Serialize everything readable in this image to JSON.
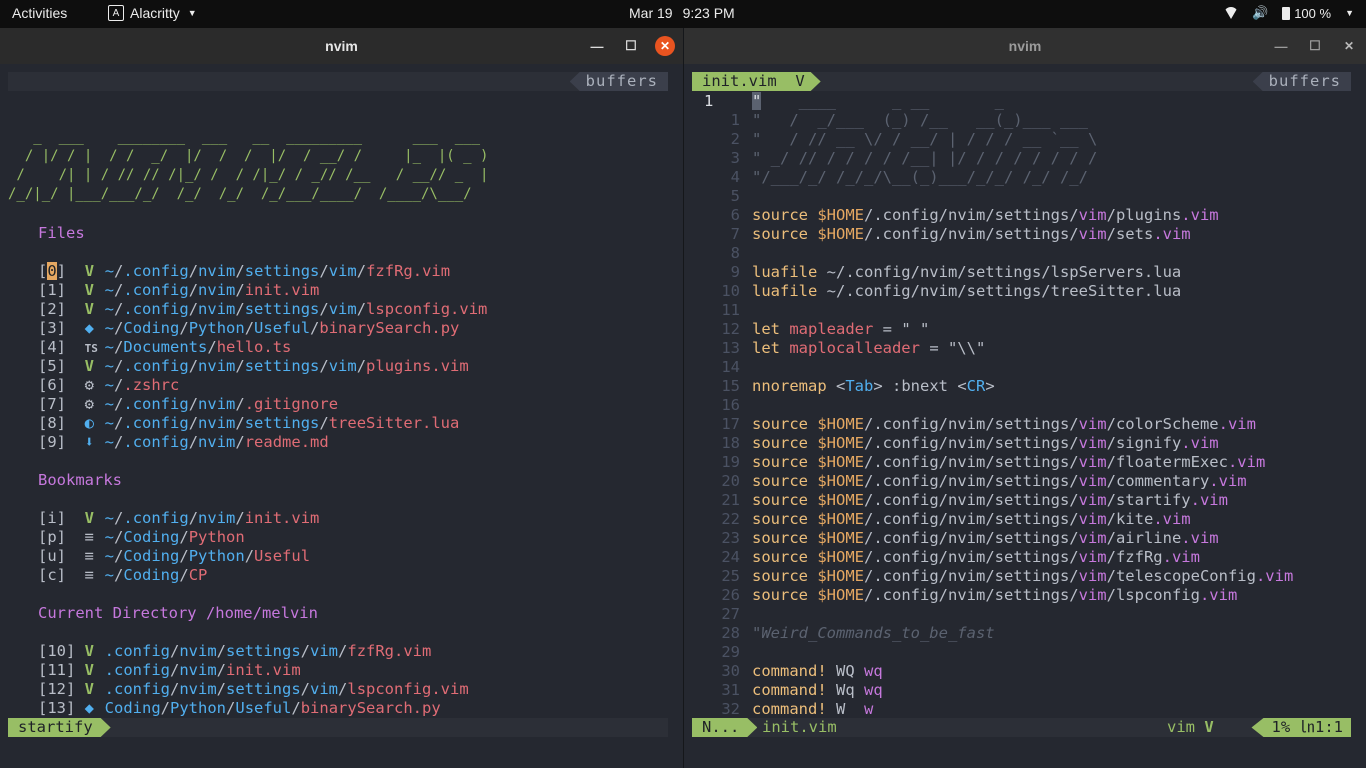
{
  "topbar": {
    "activities": "Activities",
    "app_name": "Alacritty",
    "date": "Mar 19",
    "time": "9:23 PM",
    "battery": "100 %"
  },
  "left": {
    "title": "nvim",
    "buffers_label": "buffers",
    "banner": [
      "   _  ___    ________  ___   __  _________      ___  ___",
      "  / |/ / |  / /  _/  |/  /  /  |/  / __/ /     |_  |( _ )",
      " /    /| | / // // /|_/ /  / /|_/ / _// /__   / __// _  |",
      "/_/|_/ |___/___/_/  /_/  /_/  /_/___/____/  /____/\\___/"
    ],
    "sections": {
      "files": "Files",
      "bookmarks": "Bookmarks",
      "current_dir": "Current Directory /home/melvin"
    },
    "files": [
      {
        "idx": "[0]",
        "icon": "vim-icon",
        "dir": "~/.config/nvim/settings/vim/",
        "file": "fzfRg.vim"
      },
      {
        "idx": "[1]",
        "icon": "vim-icon",
        "dir": "~/.config/nvim/",
        "file": "init.vim"
      },
      {
        "idx": "[2]",
        "icon": "vim-icon",
        "dir": "~/.config/nvim/settings/vim/",
        "file": "lspconfig.vim"
      },
      {
        "idx": "[3]",
        "icon": "python-icon",
        "dir": "~/Coding/Python/Useful/",
        "file": "binarySearch.py"
      },
      {
        "idx": "[4]",
        "icon": "typescript-icon",
        "dir": "~/Documents/",
        "file": "hello.ts"
      },
      {
        "idx": "[5]",
        "icon": "vim-icon",
        "dir": "~/.config/nvim/settings/vim/",
        "file": "plugins.vim"
      },
      {
        "idx": "[6]",
        "icon": "gear-icon",
        "dir": "~/",
        "file": ".zshrc"
      },
      {
        "idx": "[7]",
        "icon": "gear-icon",
        "dir": "~/.config/nvim/",
        "file": ".gitignore"
      },
      {
        "idx": "[8]",
        "icon": "lua-icon",
        "dir": "~/.config/nvim/settings/",
        "file": "treeSitter.lua"
      },
      {
        "idx": "[9]",
        "icon": "markdown-icon",
        "dir": "~/.config/nvim/",
        "file": "readme.md"
      }
    ],
    "bookmarks": [
      {
        "idx": "[i]",
        "icon": "vim-icon",
        "dir": "~/.config/nvim/",
        "file": "init.vim"
      },
      {
        "idx": "[p]",
        "icon": "folder-list-icon",
        "dir": "~/Coding/",
        "file": "Python"
      },
      {
        "idx": "[u]",
        "icon": "folder-list-icon",
        "dir": "~/Coding/Python/",
        "file": "Useful"
      },
      {
        "idx": "[c]",
        "icon": "folder-list-icon",
        "dir": "~/Coding/",
        "file": "CP"
      }
    ],
    "current": [
      {
        "idx": "[10]",
        "icon": "vim-icon",
        "dir": ".config/nvim/settings/vim/",
        "file": "fzfRg.vim"
      },
      {
        "idx": "[11]",
        "icon": "vim-icon",
        "dir": ".config/nvim/",
        "file": "init.vim"
      },
      {
        "idx": "[12]",
        "icon": "vim-icon",
        "dir": ".config/nvim/settings/vim/",
        "file": "lspconfig.vim"
      },
      {
        "idx": "[13]",
        "icon": "python-icon",
        "dir": "Coding/Python/Useful/",
        "file": "binarySearch.py"
      }
    ],
    "status_mode": "startify"
  },
  "right": {
    "title": "nvim",
    "active_tab": "init.vim",
    "buffers_label": "buffers",
    "code": [
      {
        "n": "1",
        "t": "\"    ____      _ __       _"
      },
      {
        "n": "1",
        "t": "\"   /  _/___  (_) /__   __(_)___ ___"
      },
      {
        "n": "2",
        "t": "\"   / // __ \\/ / __/ | / / / __ `__ \\"
      },
      {
        "n": "3",
        "t": "\" _/ // / / / / /__| |/ / / / / / / /"
      },
      {
        "n": "4",
        "t": "\"/___/_/ /_/_/\\__(_)___/_/_/ /_/ /_/"
      },
      {
        "n": "5",
        "t": ""
      },
      {
        "n": "6",
        "t": "source $HOME/.config/nvim/settings/vim/plugins.vim"
      },
      {
        "n": "7",
        "t": "source $HOME/.config/nvim/settings/vim/sets.vim"
      },
      {
        "n": "8",
        "t": ""
      },
      {
        "n": "9",
        "t": "luafile ~/.config/nvim/settings/lspServers.lua"
      },
      {
        "n": "10",
        "t": "luafile ~/.config/nvim/settings/treeSitter.lua"
      },
      {
        "n": "11",
        "t": ""
      },
      {
        "n": "12",
        "t": "let mapleader = \" \""
      },
      {
        "n": "13",
        "t": "let maplocalleader = \"\\\\\""
      },
      {
        "n": "14",
        "t": ""
      },
      {
        "n": "15",
        "t": "nnoremap <Tab> :bnext <CR>"
      },
      {
        "n": "16",
        "t": ""
      },
      {
        "n": "17",
        "t": "source $HOME/.config/nvim/settings/vim/colorScheme.vim"
      },
      {
        "n": "18",
        "t": "source $HOME/.config/nvim/settings/vim/signify.vim"
      },
      {
        "n": "19",
        "t": "source $HOME/.config/nvim/settings/vim/floatermExec.vim"
      },
      {
        "n": "20",
        "t": "source $HOME/.config/nvim/settings/vim/commentary.vim"
      },
      {
        "n": "21",
        "t": "source $HOME/.config/nvim/settings/vim/startify.vim"
      },
      {
        "n": "22",
        "t": "source $HOME/.config/nvim/settings/vim/kite.vim"
      },
      {
        "n": "23",
        "t": "source $HOME/.config/nvim/settings/vim/airline.vim"
      },
      {
        "n": "24",
        "t": "source $HOME/.config/nvim/settings/vim/fzfRg.vim"
      },
      {
        "n": "25",
        "t": "source $HOME/.config/nvim/settings/vim/telescopeConfig.vim"
      },
      {
        "n": "26",
        "t": "source $HOME/.config/nvim/settings/vim/lspconfig.vim"
      },
      {
        "n": "27",
        "t": ""
      },
      {
        "n": "28",
        "t": "\"Weird_Commands_to_be_fast"
      },
      {
        "n": "29",
        "t": ""
      },
      {
        "n": "30",
        "t": "command! WQ wq"
      },
      {
        "n": "31",
        "t": "command! Wq wq"
      },
      {
        "n": "32",
        "t": "command! W  w"
      }
    ],
    "status_mode": "N...",
    "status_file": "init.vim",
    "status_ft": "vim",
    "status_pos": "1% ",
    "status_lc": "1:1",
    "status_ln_glyph": "㏑"
  }
}
